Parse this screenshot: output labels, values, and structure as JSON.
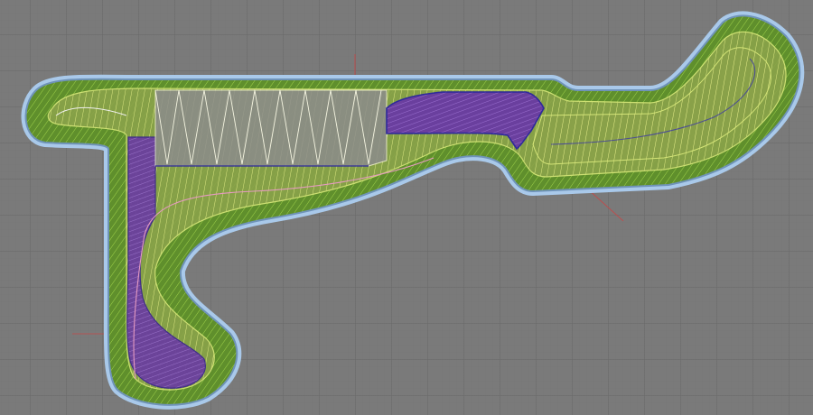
{
  "viewport": {
    "kind": "3d-viewport-wireframe",
    "subject": "race-track-mesh",
    "colors": {
      "background": "#7a7a7a",
      "grid_major": "#6b6b6b",
      "outline_outer": "#a8c8e8",
      "outline_inner": "#7fa3c7",
      "grass_mesh": "#7fbf3a",
      "track_mesh_yellow": "#e8f08a",
      "mesh_purple": "#6b3fa8",
      "edge_blue": "#2e2a9a",
      "axis_red": "#d04040"
    }
  }
}
